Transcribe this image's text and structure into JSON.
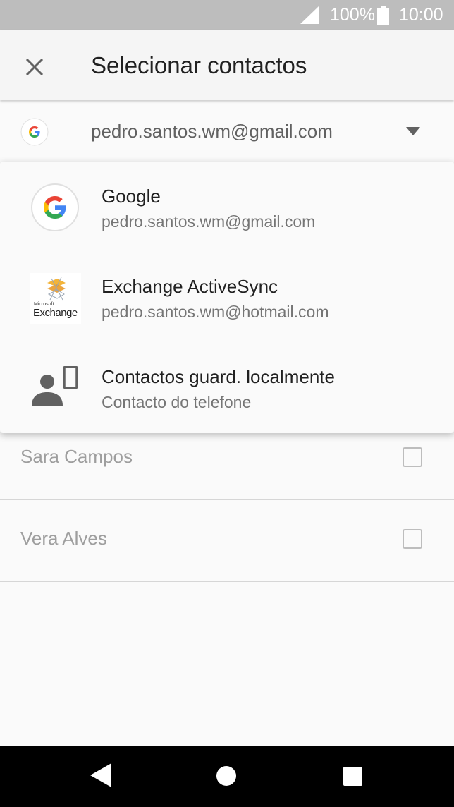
{
  "status_bar": {
    "battery": "100%",
    "time": "10:00"
  },
  "toolbar": {
    "title": "Selecionar contactos"
  },
  "account_selector": {
    "email": "pedro.santos.wm@gmail.com"
  },
  "contacts": [
    {
      "name": "Sara Campos"
    },
    {
      "name": "Vera Alves"
    }
  ],
  "dropdown": {
    "items": [
      {
        "title": "Google",
        "subtitle": "pedro.santos.wm@gmail.com",
        "icon": "google-icon"
      },
      {
        "title": "Exchange ActiveSync",
        "subtitle": "pedro.santos.wm@hotmail.com",
        "icon": "exchange-icon",
        "icon_text": "Exchange",
        "icon_small_text": "Microsoft"
      },
      {
        "title": "Contactos guard. localmente",
        "subtitle": "Contacto do telefone",
        "icon": "device-contact-icon"
      }
    ]
  },
  "colors": {
    "status_bar": "#bdbdbd",
    "toolbar": "#f5f5f5",
    "nav_bar": "#000000"
  }
}
